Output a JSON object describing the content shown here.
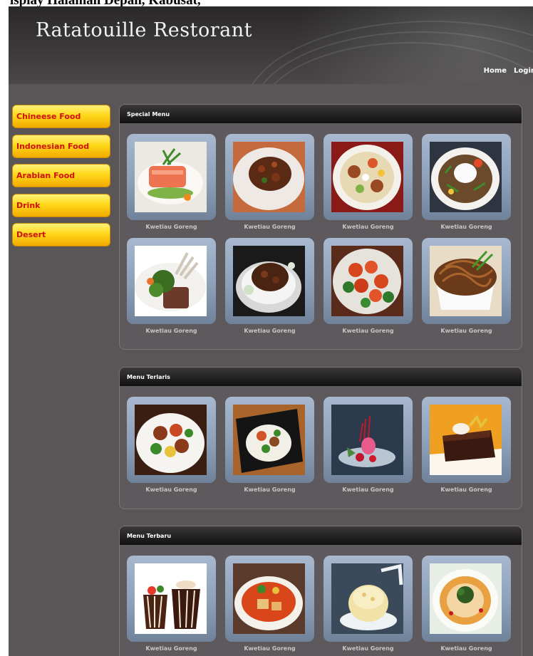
{
  "caption": "isplay Halaman Depan, Kabusat,",
  "header": {
    "title": "Ratatouille Restorant",
    "nav": [
      "Home",
      "Login"
    ]
  },
  "sidebar": {
    "items": [
      "Chineese Food",
      "Indonesian Food",
      "Arabian Food",
      "Drink",
      "Desert"
    ]
  },
  "sections": [
    {
      "title": "Special Menu",
      "items": [
        "Kwetiau Goreng",
        "Kwetiau Goreng",
        "Kwetiau Goreng",
        "Kwetiau Goreng",
        "Kwetiau Goreng",
        "Kwetiau Goreng",
        "Kwetiau Goreng",
        "Kwetiau Goreng"
      ]
    },
    {
      "title": "Menu Terlaris",
      "items": [
        "Kwetiau Goreng",
        "Kwetiau Goreng",
        "Kwetiau Goreng",
        "Kwetiau Goreng"
      ]
    },
    {
      "title": "Menu Terbaru",
      "items": [
        "Kwetiau Goreng",
        "Kwetiau Goreng",
        "Kwetiau Goreng",
        "Kwetiau Goreng"
      ]
    }
  ]
}
